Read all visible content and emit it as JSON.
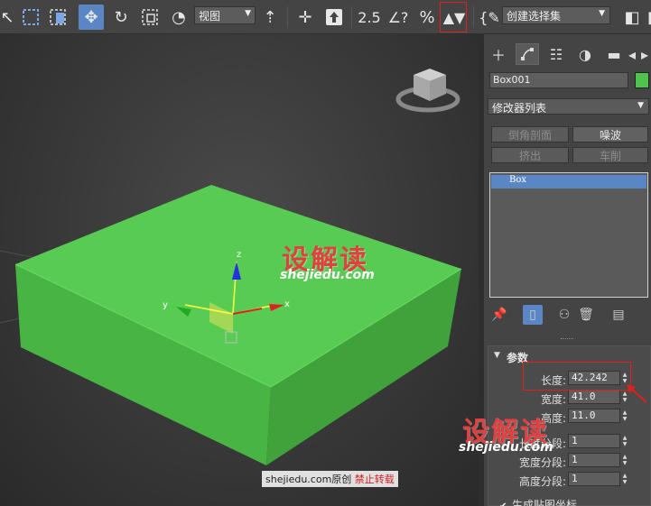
{
  "toolbar": {
    "view_dropdown": "视图",
    "named_selection": "创建选择集",
    "snap_25_label": "2.5",
    "angle_snap_label": "∠?",
    "percent_snap_label": "%",
    "spinner_snap_label": "▲▼"
  },
  "viewport": {
    "watermark_title": "设解读",
    "watermark_url": "shejiedu.com",
    "gizmo_x": "x",
    "gizmo_y": "y",
    "gizmo_z": "z",
    "footer_site": "shejiedu.com原创",
    "footer_note": "禁止转载",
    "box_color": "#4ec44a"
  },
  "panel": {
    "object_name": "Box001",
    "object_color": "#4ec44a",
    "modifier_list": "修改器列表",
    "modifier_buttons": [
      "倒角剖面",
      "噪波",
      "挤出",
      "车削"
    ],
    "stack_item": "Box",
    "rollout_title": "参数",
    "params": [
      {
        "label": "长度:",
        "value": "42.242"
      },
      {
        "label": "宽度:",
        "value": "41.0"
      },
      {
        "label": "高度:",
        "value": "11.0"
      },
      {
        "label": "长度分段:",
        "value": "1"
      },
      {
        "label": "宽度分段:",
        "value": "1"
      },
      {
        "label": "高度分段:",
        "value": "1"
      }
    ],
    "gen_mapping": "生成贴图坐标",
    "watermark_title": "设解读",
    "watermark_url": "shejiedu.com"
  },
  "colors": {
    "accent": "#5b86c5",
    "highlight_border": "#e02020",
    "box_green": "#4ec44a"
  }
}
